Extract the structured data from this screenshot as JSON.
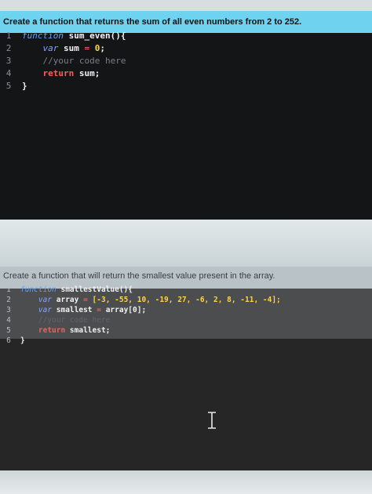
{
  "prompt1": "Create a function that returns the sum of all even numbers from 2 to 252.",
  "editor1": {
    "lines": [
      {
        "n": "1",
        "parts": [
          {
            "t": "function",
            "c": "kw-func"
          },
          {
            "t": " sum_even(){",
            "c": "ident"
          }
        ]
      },
      {
        "n": "2",
        "parts": [
          {
            "t": "    var",
            "c": "kw-var"
          },
          {
            "t": " sum ",
            "c": "ident"
          },
          {
            "t": "=",
            "c": "op"
          },
          {
            "t": " 0",
            "c": "num"
          },
          {
            "t": ";",
            "c": "punct"
          }
        ]
      },
      {
        "n": "3",
        "parts": [
          {
            "t": "    //your code here",
            "c": "cmt"
          }
        ]
      },
      {
        "n": "4",
        "parts": [
          {
            "t": "    return",
            "c": "kw-ret"
          },
          {
            "t": " sum;",
            "c": "ident"
          }
        ]
      },
      {
        "n": "5",
        "parts": [
          {
            "t": "}",
            "c": "ident"
          }
        ]
      }
    ]
  },
  "prompt2": "Create a function that will return the smallest value present in the array.",
  "editor2": {
    "lines": [
      {
        "n": "1",
        "parts": [
          {
            "t": "function",
            "c": "kw-func"
          },
          {
            "t": " smallestValue(){",
            "c": "ident"
          }
        ]
      },
      {
        "n": "2",
        "parts": [
          {
            "t": "    var",
            "c": "kw-var"
          },
          {
            "t": " array ",
            "c": "ident"
          },
          {
            "t": "=",
            "c": "op"
          },
          {
            "t": " [-3, -55, 10, -19, 27, -6, 2, 8, -11, -4];",
            "c": "num"
          }
        ]
      },
      {
        "n": "3",
        "parts": [
          {
            "t": "    var",
            "c": "kw-var"
          },
          {
            "t": " smallest ",
            "c": "ident"
          },
          {
            "t": "=",
            "c": "op"
          },
          {
            "t": " array[0];",
            "c": "ident"
          }
        ]
      },
      {
        "n": "4",
        "parts": [
          {
            "t": "    //your code here",
            "c": "cmt"
          }
        ]
      },
      {
        "n": "5",
        "parts": [
          {
            "t": "    return",
            "c": "kw-ret"
          },
          {
            "t": " smallest;",
            "c": "ident"
          }
        ]
      },
      {
        "n": "6",
        "parts": [
          {
            "t": "}",
            "c": "ident"
          }
        ]
      }
    ]
  }
}
